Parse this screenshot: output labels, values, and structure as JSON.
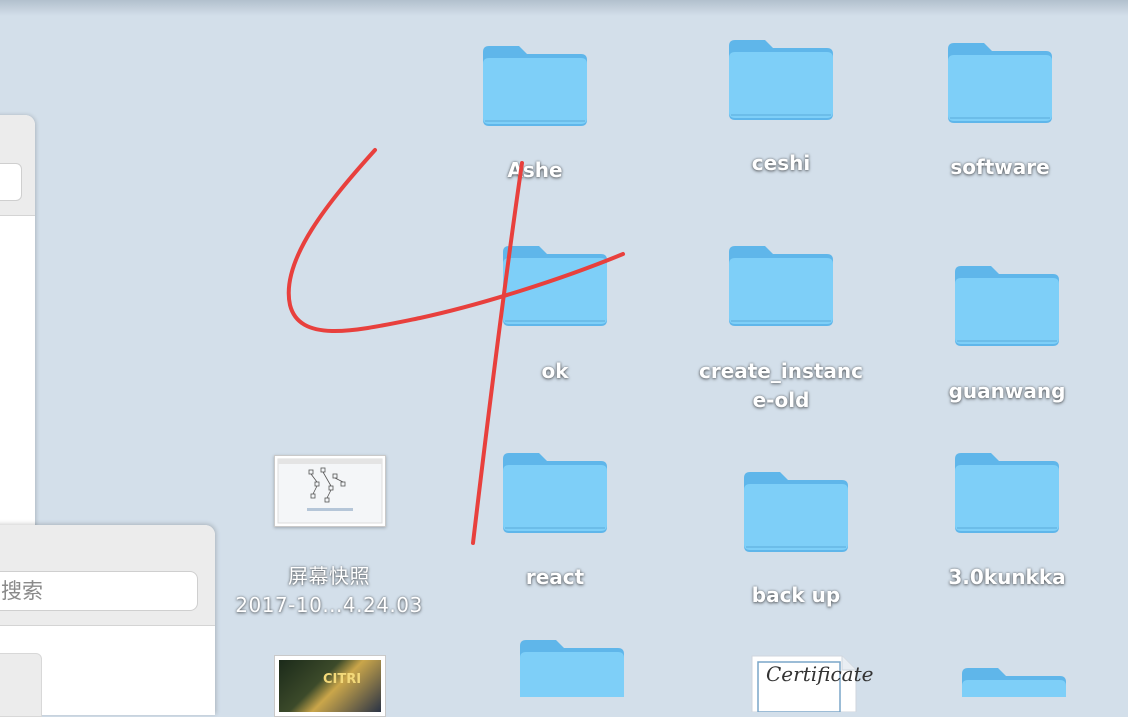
{
  "desktop": {
    "items": [
      {
        "label": "Ashe",
        "kind": "folder"
      },
      {
        "label": "ceshi",
        "kind": "folder"
      },
      {
        "label": "software",
        "kind": "folder"
      },
      {
        "label": "ok",
        "kind": "folder"
      },
      {
        "label": "create_instance-old",
        "kind": "folder"
      },
      {
        "label": "guanwang",
        "kind": "folder"
      },
      {
        "label": "屏幕快照\n2017-10...4.24.03",
        "kind": "screenshot-file"
      },
      {
        "label": "react",
        "kind": "folder"
      },
      {
        "label": "back up",
        "kind": "folder"
      },
      {
        "label": "3.0kunkka",
        "kind": "folder"
      }
    ],
    "partial_icons": {
      "photo_text": "CITRI",
      "certificate_text": "Certificate"
    }
  },
  "finder_window": {
    "search_placeholder": "搜索"
  },
  "colors": {
    "desktop_bg": "#d3dfea",
    "folder_blue": "#7ecff8",
    "annotation_red": "#e8403d"
  },
  "icons": {
    "folder": "folder-icon",
    "screenshot": "screenshot-file-icon",
    "photo": "image-file-icon",
    "certificate": "certificate-file-icon"
  }
}
